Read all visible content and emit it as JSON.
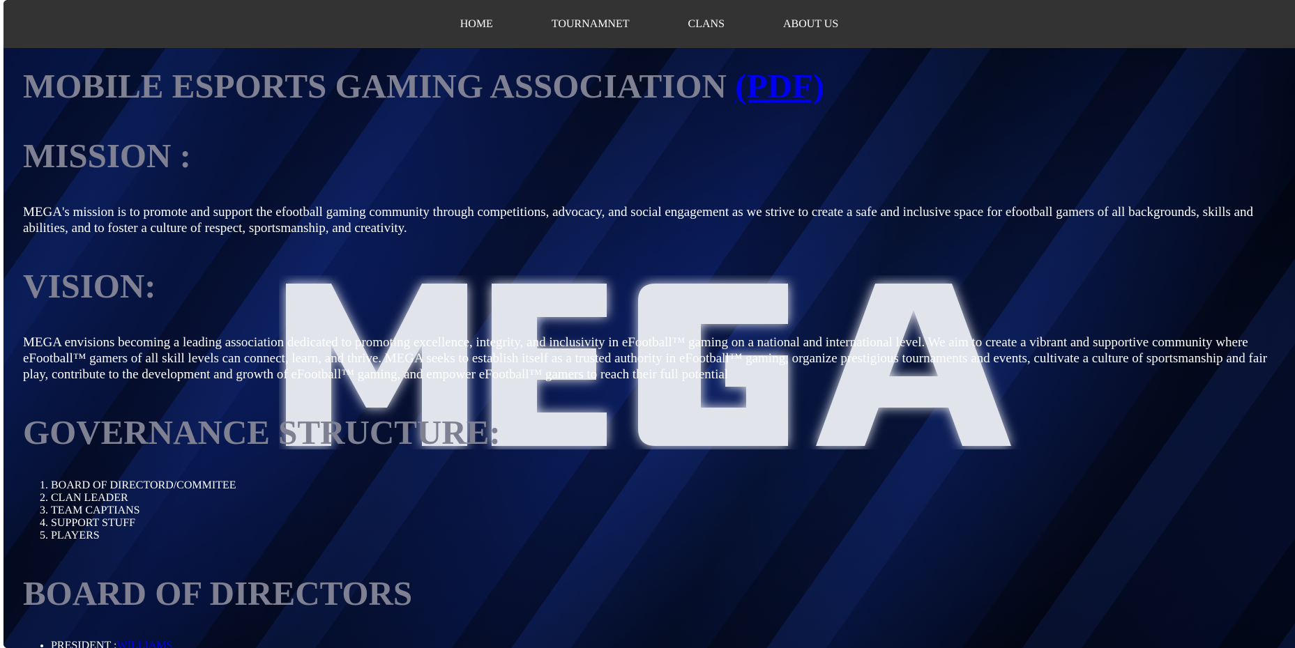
{
  "nav": {
    "items": [
      {
        "label": "HOME"
      },
      {
        "label": "TOURNAMNET"
      },
      {
        "label": "CLANS"
      },
      {
        "label": "ABOUT US"
      }
    ]
  },
  "header": {
    "title": "MOBILE ESPORTS GAMING ASSOCIATION",
    "pdf_link": "(PDF)"
  },
  "logo": {
    "text": "MEGA"
  },
  "mission": {
    "heading": "MISSION :",
    "text": "MEGA's mission is to promote and support the efootball gaming community through competitions, advocacy, and social engagement as we strive to create a safe and inclusive space for efootball gamers of all backgrounds, skills and abilities, and to foster a culture of respect, sportsmanship, and creativity."
  },
  "vision": {
    "heading": "VISION:",
    "text": "MEGA envisions becoming a leading association dedicated to promoting excellence, integrity, and inclusivity in eFootball™ gaming on a national and international level. We aim to create a vibrant and supportive community where eFootball™ gamers of all skill levels can connect, learn, and thrive. MEGA seeks to establish itself as a trusted authority in eFootball™ gaming, organize prestigious tournaments and events, cultivate a culture of sportsmanship and fair play, contribute to the development and growth of eFootball™ gaming, and empower eFootball™ gamers to reach their full potential"
  },
  "governance": {
    "heading": "GOVERNANCE STRUCTURE:",
    "items": [
      "BOARD OF DIRECTORD/COMMITEE",
      "CLAN LEADER",
      "TEAM CAPTIANS",
      "SUPPORT STUFF",
      "PLAYERS"
    ]
  },
  "board": {
    "heading": "BOARD OF DIRECTORS",
    "items": [
      {
        "role": "PRESIDENT :",
        "name": "WILLIAMS"
      }
    ]
  },
  "colors": {
    "navbar": "#333333",
    "heading": "#7f8193",
    "link": "#0000ee",
    "text": "#ffffff"
  }
}
